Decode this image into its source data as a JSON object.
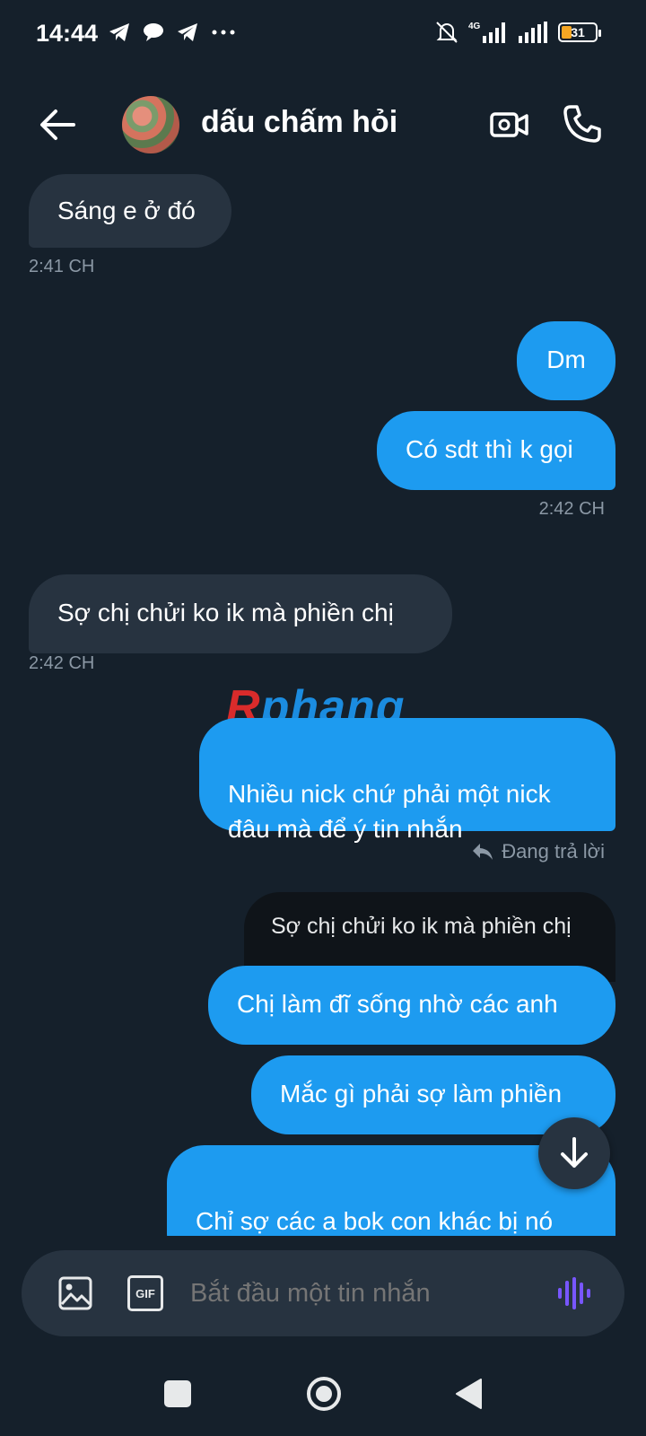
{
  "status_bar": {
    "time": "14:44",
    "network": "4G",
    "battery": "31"
  },
  "header": {
    "contact_name": "dấu chấm hỏi"
  },
  "messages": [
    {
      "side": "received",
      "text": "Sáng e ở đó"
    },
    {
      "side": "received",
      "time": "2:41 CH"
    },
    {
      "side": "sent",
      "text": "Dm"
    },
    {
      "side": "sent",
      "text": "Có sdt thì k gọi"
    },
    {
      "side": "sent",
      "time": "2:42 CH"
    },
    {
      "side": "received",
      "text": "Sợ chị chửi ko ik mà phiền chị"
    },
    {
      "side": "received",
      "time": "2:42 CH"
    },
    {
      "side": "sent",
      "text": "Nhiều nick chứ phải một nick\nđâu mà để ý tin nhắn"
    },
    {
      "side": "sent",
      "text": "Chị làm đĩ sống nhờ các anh"
    },
    {
      "side": "sent",
      "text": "Mắc gì phải sợ làm phiền"
    },
    {
      "side": "sent",
      "text": "Chỉ sợ các a bok con khác bị nó\nlừa bị nó lây bênh thôi"
    }
  ],
  "reply": {
    "label": "Đang trả lời",
    "quoted_text": "Sợ chị chửi ko ik mà phiền chị"
  },
  "watermark": {
    "first_letter": "R",
    "rest": "phang"
  },
  "composer": {
    "placeholder": "Bắt đầu một tin nhắn",
    "gif_label": "GIF"
  },
  "colors": {
    "background": "#15202b",
    "sent_bubble": "#1d9bf0",
    "received_bubble": "#273340",
    "muted_text": "#8b98a5",
    "voice_accent": "#7856ff"
  }
}
